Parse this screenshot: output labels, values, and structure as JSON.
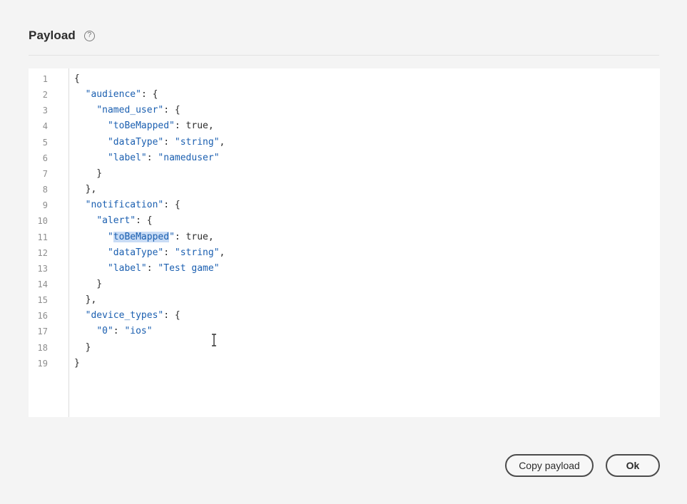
{
  "header": {
    "title": "Payload",
    "help_glyph": "?",
    "help_icon": "help-circle-icon"
  },
  "editor": {
    "line_numbers": [
      "1",
      "2",
      "3",
      "4",
      "5",
      "6",
      "7",
      "8",
      "9",
      "10",
      "11",
      "12",
      "13",
      "14",
      "15",
      "16",
      "17",
      "18",
      "19"
    ],
    "lines": [
      "{",
      "  \"audience\": {",
      "    \"named_user\": {",
      "      \"toBeMapped\": true,",
      "      \"dataType\": \"string\",",
      "      \"label\": \"nameduser\"",
      "    }",
      "  },",
      "  \"notification\": {",
      "    \"alert\": {",
      "      \"toBeMapped\": true,",
      "      \"dataType\": \"string\",",
      "      \"label\": \"Test game\"",
      "    }",
      "  },",
      "  \"device_types\": {",
      "    \"0\": \"ios\"",
      "  }",
      "}"
    ],
    "highlighted_text": "toBeMapped",
    "highlighted_line_index": 10,
    "mouse_cursor": "text-ibeam-cursor"
  },
  "footer": {
    "copy_label": "Copy payload",
    "ok_label": "Ok"
  },
  "colors": {
    "key": "#1b5fb0",
    "text": "#2c2c2c",
    "selection": "#c9dcf5",
    "background": "#f4f4f4"
  }
}
